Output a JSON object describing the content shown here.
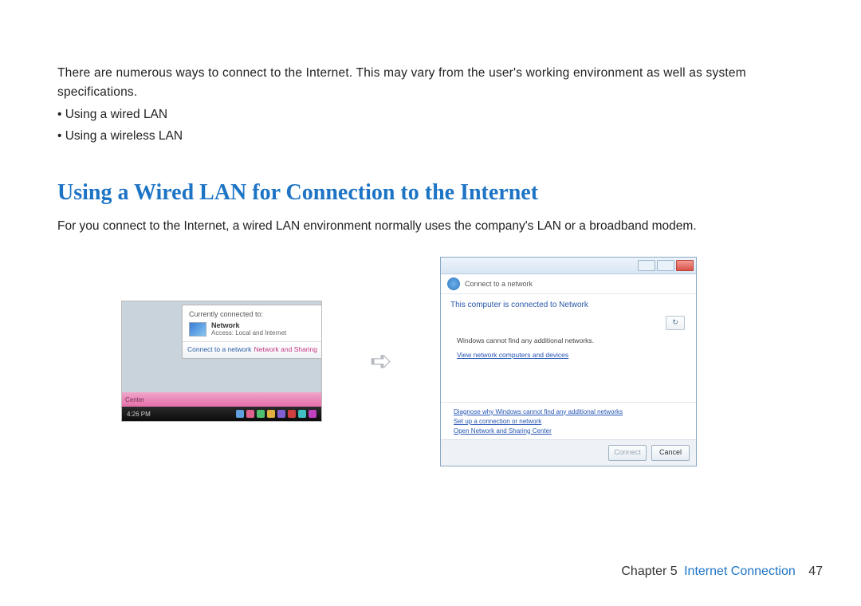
{
  "intro": "There are numerous ways to connect to the Internet. This may vary from the user's working environment as well as system specifications.",
  "bullets": [
    "Using a wired LAN",
    "Using a wireless LAN"
  ],
  "heading": "Using a Wired LAN for Connection to the Internet",
  "desc": "For you connect to the Internet, a wired LAN environment normally uses the company's LAN or a broadband modem.",
  "fig_left": {
    "currently": "Currently connected to:",
    "net_name": "Network",
    "net_access": "Access:  Local and Internet",
    "connect_link": "Connect to a network",
    "sharing_link": "Network and Sharing",
    "pink_left": "Center",
    "time": "4:26 PM"
  },
  "fig_right": {
    "crumb": "Connect to a network",
    "banner": "This computer is connected to Network",
    "refresh": "↻",
    "msg": "Windows cannot find any additional networks.",
    "link_view": "View network computers and devices",
    "link_diag": "Diagnose why Windows cannot find any additional networks",
    "link_setup": "Set up a connection or network",
    "link_open": "Open Network and Sharing Center",
    "btn_connect": "Connect",
    "btn_cancel": "Cancel"
  },
  "footer": {
    "chapter": "Chapter 5",
    "title": "Internet Connection",
    "page": "47"
  },
  "tray_colors": [
    "#60a0e0",
    "#e06090",
    "#50c070",
    "#e0b040",
    "#8060d0",
    "#d04040",
    "#40c0c0",
    "#c040c0"
  ]
}
